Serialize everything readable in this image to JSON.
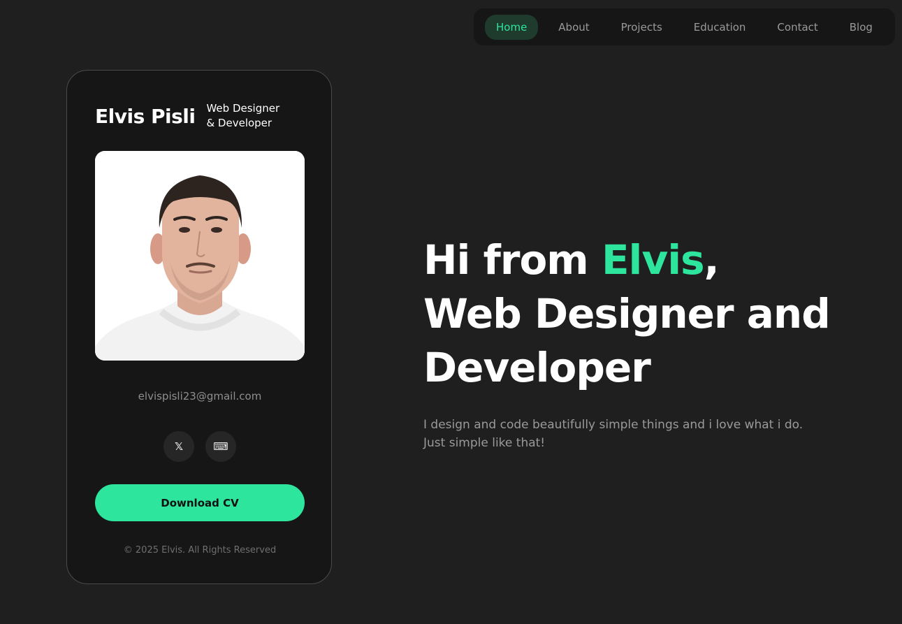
{
  "nav": {
    "items": [
      {
        "label": "Home",
        "active": true
      },
      {
        "label": "About",
        "active": false
      },
      {
        "label": "Projects",
        "active": false
      },
      {
        "label": "Education",
        "active": false
      },
      {
        "label": "Contact",
        "active": false
      },
      {
        "label": "Blog",
        "active": false
      }
    ]
  },
  "profile": {
    "name": "Elvis Pisli",
    "role_line1": "Web Designer",
    "role_line2": "& Developer",
    "email": "elvispisli23@gmail.com",
    "socials": [
      {
        "icon": "x-twitter-icon",
        "glyph": "𝕏"
      },
      {
        "icon": "keyboard-icon",
        "glyph": "⌨"
      }
    ],
    "cv_button": "Download CV",
    "copyright": "© 2025 Elvis. All Rights Reserved"
  },
  "hero": {
    "greeting_prefix": "Hi from ",
    "greeting_name": "Elvis",
    "greeting_suffix": ",",
    "title_line2": "Web Designer and",
    "title_line3": "Developer",
    "subtitle": "I design and code beautifully simple things and i love what i do. Just simple like that!"
  },
  "colors": {
    "background": "#1f1f1f",
    "card": "#161616",
    "accent": "#2ee59d",
    "nav_active_bg": "#1e3b2e",
    "muted_text": "#9a9a9a"
  }
}
